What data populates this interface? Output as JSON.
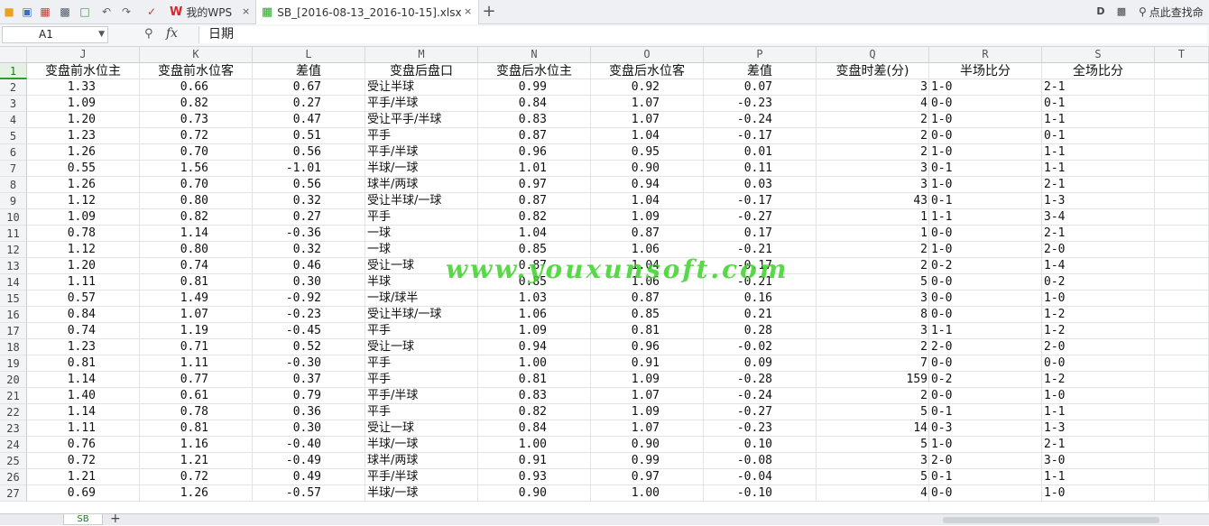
{
  "tabs": {
    "home": "我的WPS",
    "file": "SB_[2016-08-13_2016-10-15].xlsx",
    "close_glyph": "×",
    "new_glyph": "+"
  },
  "search": {
    "placeholder": "点此查找命"
  },
  "formula_bar": {
    "cell_ref": "A1",
    "fx": "fx",
    "content": "日期"
  },
  "columns": [
    "J",
    "K",
    "L",
    "M",
    "N",
    "O",
    "P",
    "Q",
    "R",
    "S",
    "T"
  ],
  "header": [
    "变盘前水位主",
    "变盘前水位客",
    "差值",
    "变盘后盘口",
    "变盘后水位主",
    "变盘后水位客",
    "差值",
    "变盘时差(分)",
    "半场比分",
    "全场比分",
    ""
  ],
  "rows": [
    [
      "2",
      "1.33",
      "0.66",
      "0.67",
      "受让半球",
      "0.99",
      "0.92",
      "0.07",
      "3",
      "1-0",
      "2-1"
    ],
    [
      "3",
      "1.09",
      "0.82",
      "0.27",
      "平手/半球",
      "0.84",
      "1.07",
      "-0.23",
      "4",
      "0-0",
      "0-1"
    ],
    [
      "4",
      "1.20",
      "0.73",
      "0.47",
      "受让平手/半球",
      "0.83",
      "1.07",
      "-0.24",
      "2",
      "1-0",
      "1-1"
    ],
    [
      "5",
      "1.23",
      "0.72",
      "0.51",
      "平手",
      "0.87",
      "1.04",
      "-0.17",
      "2",
      "0-0",
      "0-1"
    ],
    [
      "6",
      "1.26",
      "0.70",
      "0.56",
      "平手/半球",
      "0.96",
      "0.95",
      "0.01",
      "2",
      "1-0",
      "1-1"
    ],
    [
      "7",
      "0.55",
      "1.56",
      "-1.01",
      "半球/一球",
      "1.01",
      "0.90",
      "0.11",
      "3",
      "0-1",
      "1-1"
    ],
    [
      "8",
      "1.26",
      "0.70",
      "0.56",
      "球半/两球",
      "0.97",
      "0.94",
      "0.03",
      "3",
      "1-0",
      "2-1"
    ],
    [
      "9",
      "1.12",
      "0.80",
      "0.32",
      "受让半球/一球",
      "0.87",
      "1.04",
      "-0.17",
      "43",
      "0-1",
      "1-3"
    ],
    [
      "10",
      "1.09",
      "0.82",
      "0.27",
      "平手",
      "0.82",
      "1.09",
      "-0.27",
      "1",
      "1-1",
      "3-4"
    ],
    [
      "11",
      "0.78",
      "1.14",
      "-0.36",
      "一球",
      "1.04",
      "0.87",
      "0.17",
      "1",
      "0-0",
      "2-1"
    ],
    [
      "12",
      "1.12",
      "0.80",
      "0.32",
      "一球",
      "0.85",
      "1.06",
      "-0.21",
      "2",
      "1-0",
      "2-0"
    ],
    [
      "13",
      "1.20",
      "0.74",
      "0.46",
      "受让一球",
      "0.87",
      "1.04",
      "-0.17",
      "2",
      "0-2",
      "1-4"
    ],
    [
      "14",
      "1.11",
      "0.81",
      "0.30",
      "半球",
      "0.85",
      "1.06",
      "-0.21",
      "5",
      "0-0",
      "0-2"
    ],
    [
      "15",
      "0.57",
      "1.49",
      "-0.92",
      "一球/球半",
      "1.03",
      "0.87",
      "0.16",
      "3",
      "0-0",
      "1-0"
    ],
    [
      "16",
      "0.84",
      "1.07",
      "-0.23",
      "受让半球/一球",
      "1.06",
      "0.85",
      "0.21",
      "8",
      "0-0",
      "1-2"
    ],
    [
      "17",
      "0.74",
      "1.19",
      "-0.45",
      "平手",
      "1.09",
      "0.81",
      "0.28",
      "3",
      "1-1",
      "1-2"
    ],
    [
      "18",
      "1.23",
      "0.71",
      "0.52",
      "受让一球",
      "0.94",
      "0.96",
      "-0.02",
      "2",
      "2-0",
      "2-0"
    ],
    [
      "19",
      "0.81",
      "1.11",
      "-0.30",
      "平手",
      "1.00",
      "0.91",
      "0.09",
      "7",
      "0-0",
      "0-0"
    ],
    [
      "20",
      "1.14",
      "0.77",
      "0.37",
      "平手",
      "0.81",
      "1.09",
      "-0.28",
      "159",
      "0-2",
      "1-2"
    ],
    [
      "21",
      "1.40",
      "0.61",
      "0.79",
      "平手/半球",
      "0.83",
      "1.07",
      "-0.24",
      "2",
      "0-0",
      "1-0"
    ],
    [
      "22",
      "1.14",
      "0.78",
      "0.36",
      "平手",
      "0.82",
      "1.09",
      "-0.27",
      "5",
      "0-1",
      "1-1"
    ],
    [
      "23",
      "1.11",
      "0.81",
      "0.30",
      "受让一球",
      "0.84",
      "1.07",
      "-0.23",
      "14",
      "0-3",
      "1-3"
    ],
    [
      "24",
      "0.76",
      "1.16",
      "-0.40",
      "半球/一球",
      "1.00",
      "0.90",
      "0.10",
      "5",
      "1-0",
      "2-1"
    ],
    [
      "25",
      "0.72",
      "1.21",
      "-0.49",
      "球半/两球",
      "0.91",
      "0.99",
      "-0.08",
      "3",
      "2-0",
      "3-0"
    ],
    [
      "26",
      "1.21",
      "0.72",
      "0.49",
      "平手/半球",
      "0.93",
      "0.97",
      "-0.04",
      "5",
      "0-1",
      "1-1"
    ],
    [
      "27",
      "0.69",
      "1.26",
      "-0.57",
      "半球/一球",
      "0.90",
      "1.00",
      "-0.10",
      "4",
      "0-0",
      "1-0"
    ]
  ],
  "watermark": "www.youxunsoft.com",
  "sheet": {
    "name": "SB",
    "add_glyph": "+"
  },
  "icons": [
    "folder-icon",
    "save-icon",
    "export-pdf-icon",
    "print-icon",
    "print-preview-icon",
    "undo-icon",
    "redo-icon",
    "format-painter-icon",
    "wps-logo-icon",
    "spreadsheet-file-icon",
    "ribbon-collapse-icon",
    "skin-icon",
    "search-icon"
  ],
  "colors": {
    "accent": "#2e9d2e",
    "wps_red": "#d7262c",
    "watermark": "#3cd228"
  }
}
